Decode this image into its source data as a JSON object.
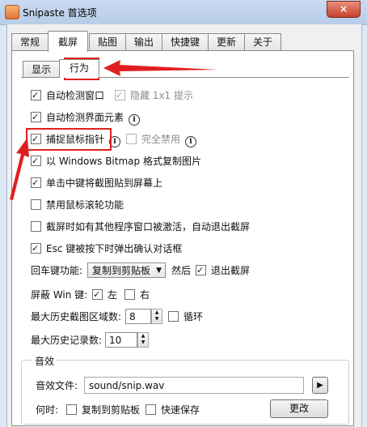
{
  "window": {
    "title": "Snipaste 首选项",
    "close_glyph": "×"
  },
  "tabs": [
    "常规",
    "截屏",
    "贴图",
    "输出",
    "快捷键",
    "更新",
    "关于"
  ],
  "active_tab": "截屏",
  "subtabs": [
    "显示",
    "行为"
  ],
  "active_subtab": "行为",
  "options": {
    "auto_detect_window": {
      "label": "自动检测窗口",
      "checked": true
    },
    "hide_1x1": {
      "label": "隐藏 1x1 提示",
      "checked": true,
      "disabled": true
    },
    "auto_detect_elements": {
      "label": "自动检测界面元素",
      "checked": true
    },
    "capture_cursor": {
      "label": "捕捉鼠标指针",
      "checked": true
    },
    "fully_disable": {
      "label": "完全禁用",
      "checked": false,
      "disabled": true
    },
    "copy_bitmap": {
      "label": "以 Windows Bitmap 格式复制图片",
      "checked": true
    },
    "middle_click_paste": {
      "label": "单击中键将截图贴到屏幕上",
      "checked": true
    },
    "disable_wheel": {
      "label": "禁用鼠标滚轮功能",
      "checked": false
    },
    "auto_exit": {
      "label": "截屏时如有其他程序窗口被激活，自动退出截屏",
      "checked": false
    },
    "esc_confirm": {
      "label": "Esc 键被按下时弹出确认对话框",
      "checked": true
    }
  },
  "enter_key": {
    "label": "回车键功能:",
    "value": "复制到剪贴板",
    "then_label": "然后",
    "exit_label": "退出截屏",
    "exit_checked": true
  },
  "block_win": {
    "label": "屏蔽 Win 键:",
    "left_label": "左",
    "left_checked": true,
    "right_label": "右",
    "right_checked": false
  },
  "history_regions": {
    "label": "最大历史截图区域数:",
    "value": "8",
    "loop_label": "循环",
    "loop_checked": false
  },
  "history_records": {
    "label": "最大历史记录数:",
    "value": "10"
  },
  "sound": {
    "group_label": "音效",
    "file_label": "音效文件:",
    "file_value": "sound/snip.wav",
    "play_glyph": "▶",
    "when_label": "何时:",
    "copy_label": "复制到剪贴板",
    "copy_checked": false,
    "save_label": "快速保存",
    "save_checked": false,
    "change_label": "更改"
  },
  "icons": {
    "info": "i",
    "spin_up": "▲",
    "spin_down": "▼",
    "dropdown": "▼"
  },
  "colors": {
    "annotation_red": "#e02020",
    "title_bar": "#c9daf0",
    "close_button": "#c8412b"
  }
}
